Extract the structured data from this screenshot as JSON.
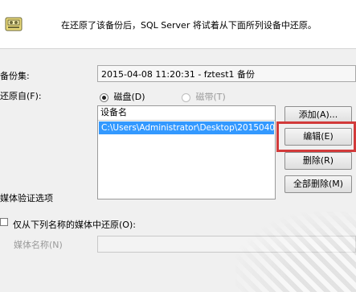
{
  "header": {
    "message": "在还原了该备份后，SQL Server 将试着从下面所列设备中还原。"
  },
  "backup_set": {
    "label": "备份集:",
    "value": "2015-04-08 11:20:31 - fztest1 备份"
  },
  "restore_from": {
    "label": "还原自(F):",
    "options": [
      {
        "label": "磁盘(D)",
        "selected": true,
        "enabled": true
      },
      {
        "label": "磁带(T)",
        "selected": false,
        "enabled": false
      }
    ]
  },
  "device_list": {
    "column_header": "设备名",
    "rows": [
      "C:\\Users\\Administrator\\Desktop\\2015040..."
    ]
  },
  "buttons": {
    "add": "添加(A)...",
    "edit": "编辑(E)",
    "remove": "删除(R)",
    "remove_all": "全部删除(M)"
  },
  "media_verify": {
    "section_title": "媒体验证选项",
    "checkbox_label": "仅从下列名称的媒体中还原(O):",
    "checked": false,
    "media_name_label": "媒体名称(N)",
    "media_name_value": ""
  },
  "colors": {
    "selection": "#3399ff",
    "highlight_box": "#d23a3a"
  }
}
